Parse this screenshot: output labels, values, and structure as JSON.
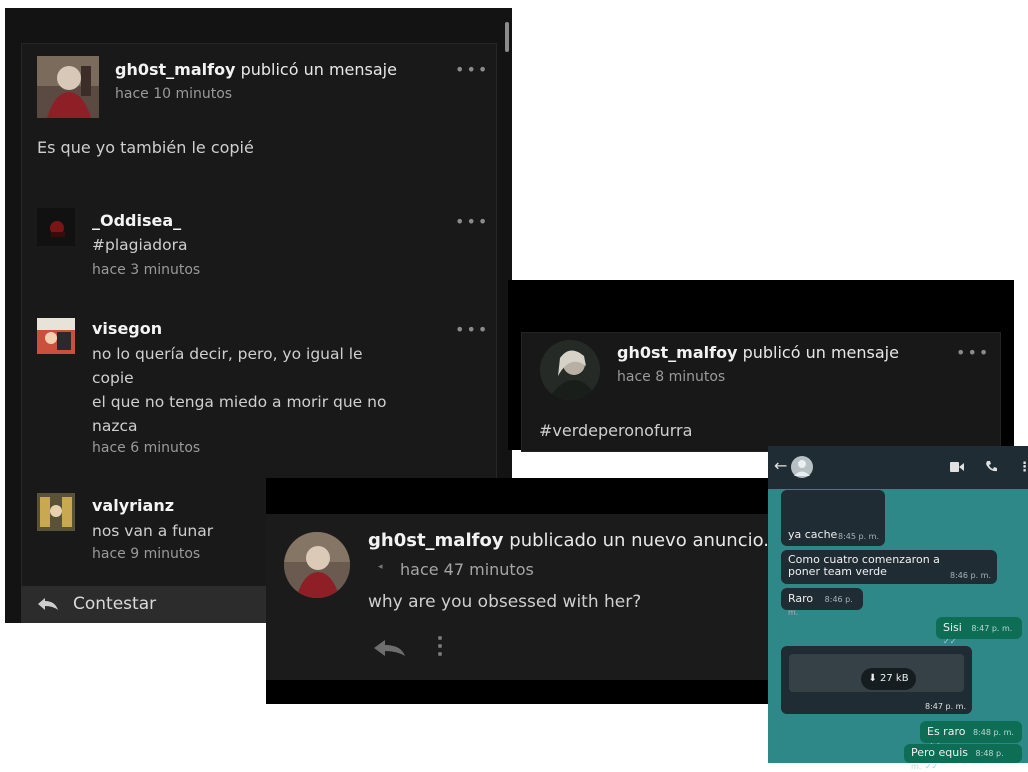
{
  "shot1": {
    "post": {
      "user": "gh0st_malfoy",
      "action": "publicó un mensaje",
      "time": "hace 10 minutos",
      "text": "Es que yo también le copié"
    },
    "comments": [
      {
        "user": "_Oddisea_",
        "lines": [
          "#plagiadora"
        ],
        "time": "hace 3 minutos"
      },
      {
        "user": "visegon",
        "lines": [
          "no lo quería decir, pero, yo igual le",
          "copie",
          "el que no tenga miedo a morir que no",
          "nazca"
        ],
        "time": "hace 6 minutos"
      },
      {
        "user": "valyrianz",
        "lines": [
          "nos van a funar"
        ],
        "time": "hace 9 minutos"
      }
    ],
    "reply_label": "Contestar",
    "more_icon": "•••"
  },
  "shot2": {
    "user": "gh0st_malfoy",
    "action": "publicó un mensaje",
    "time": "hace 8 minutos",
    "text": "#verdeperonofurra",
    "more_icon": "•••"
  },
  "shot3": {
    "user": "gh0st_malfoy",
    "action": "publicado un nuevo anuncio.",
    "time": "hace 47 minutos",
    "text": "why are you obsessed with her?"
  },
  "chat": {
    "messages": [
      {
        "dir": "in",
        "text": "ya cache",
        "time": "8:45 p. m."
      },
      {
        "dir": "in",
        "text": "Como cuatro comenzaron a poner team verde",
        "time": "8:46 p. m."
      },
      {
        "dir": "in",
        "text": "Raro",
        "time": "8:46 p. m."
      },
      {
        "dir": "out",
        "text": "Sisi",
        "time": "8:47 p. m."
      },
      {
        "dir": "in",
        "text": "27 kB",
        "time": "8:47 p. m."
      },
      {
        "dir": "out",
        "text": "Es raro",
        "time": "8:48 p. m."
      },
      {
        "dir": "out",
        "text": "Pero equis",
        "time": "8:48 p. m."
      }
    ],
    "colors": {
      "background": "#2f8888",
      "incoming": "#202c33",
      "outgoing": "#0d6d55",
      "header": "#1f2c33"
    }
  }
}
